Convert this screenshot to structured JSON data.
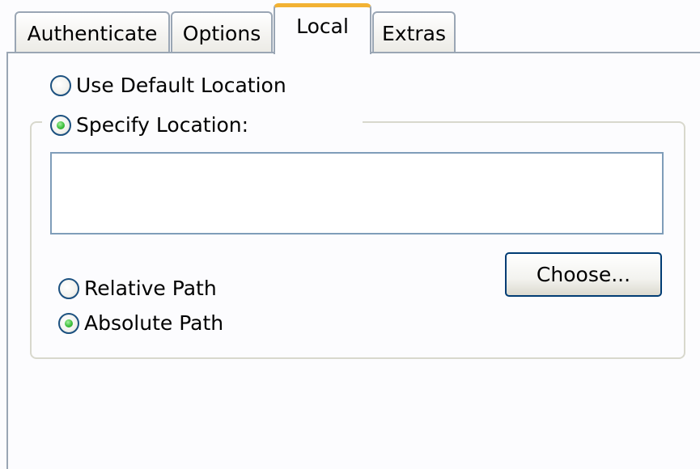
{
  "tabs": [
    {
      "label": "Authenticate",
      "selected": false
    },
    {
      "label": "Options",
      "selected": false
    },
    {
      "label": "Local",
      "selected": true
    },
    {
      "label": "Extras",
      "selected": false
    }
  ],
  "location": {
    "use_default_label": "Use Default Location",
    "use_default_checked": false,
    "specify_label": "Specify Location:",
    "specify_checked": true,
    "path_value": ""
  },
  "path_type": {
    "relative_label": "Relative Path",
    "relative_checked": false,
    "absolute_label": "Absolute Path",
    "absolute_checked": true
  },
  "choose_button_label": "Choose...",
  "colors": {
    "tab_highlight": "#f2b233",
    "border": "#9aa6b4",
    "radio_dot": "#3ec13e",
    "button_border": "#003c74"
  }
}
